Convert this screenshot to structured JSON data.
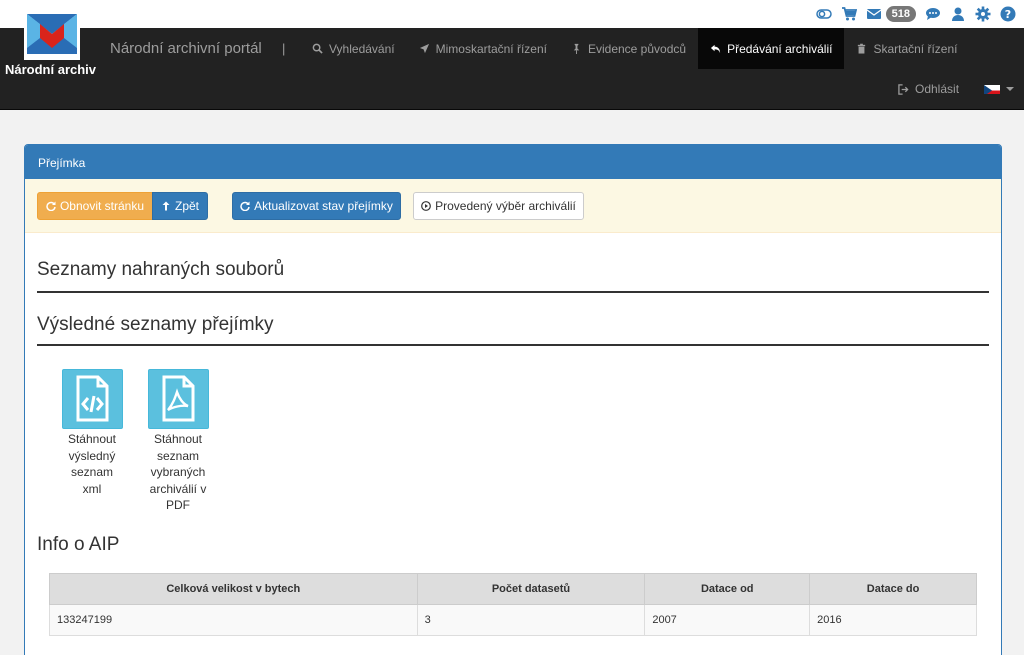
{
  "logo": {
    "text": "Národní archiv"
  },
  "top_icons": {
    "items": [
      "toggle-icon",
      "cart-icon",
      "envelope-icon",
      "comments-icon",
      "user-icon",
      "gear-icon",
      "help-icon"
    ],
    "message_count": "518"
  },
  "navbar": {
    "brand": "Národní archivní portál",
    "separator": "|",
    "items": [
      {
        "label": "Vyhledávání",
        "icon": "search-icon"
      },
      {
        "label": "Mimoskartační řízení",
        "icon": "send-icon"
      },
      {
        "label": "Evidence původců",
        "icon": "pushpin-icon"
      },
      {
        "label": "Předávání archiválií",
        "icon": "reply-icon",
        "active": true
      },
      {
        "label": "Skartační řízení",
        "icon": "trash-icon"
      }
    ],
    "logout_label": "Odhlásit",
    "language": "cs"
  },
  "panel": {
    "heading": "Přejímka",
    "toolbar": {
      "refresh_label": "Obnovit stránku",
      "back_label": "Zpět",
      "update_label": "Aktualizovat stav přejímky",
      "selection_label": "Provedený výběr archiválií"
    },
    "section_uploaded": "Seznamy nahraných souborů",
    "section_results": "Výsledné seznamy přejímky",
    "downloads": [
      {
        "lines": [
          "Stáhnout",
          "výsledný",
          "seznam",
          "xml"
        ],
        "icon": "file-code-icon"
      },
      {
        "lines": [
          "Stáhnout",
          "seznam",
          "vybraných",
          "archiválií v",
          "PDF"
        ],
        "icon": "file-pdf-icon"
      }
    ],
    "section_aip": "Info o AIP",
    "aip_table": {
      "headers": [
        "Celková velikost v bytech",
        "Počet datasetů",
        "Datace od",
        "Datace do"
      ],
      "rows": [
        [
          "133247199",
          "3",
          "2007",
          "2016"
        ]
      ]
    }
  },
  "colors": {
    "navbar": "#222222",
    "primary": "#337ab7",
    "warning": "#f0ad4e",
    "info": "#5bc0de",
    "toolbar_bg": "#fcf8e3",
    "icon_blue": "#337ab7"
  }
}
